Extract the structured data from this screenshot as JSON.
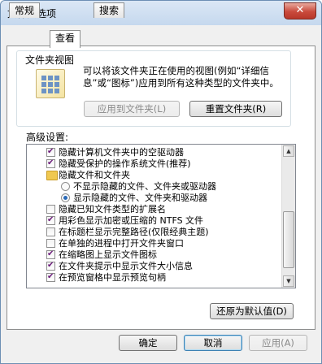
{
  "window": {
    "title": "文件夹选项",
    "close_glyph": "✕"
  },
  "tabs": [
    {
      "label": "常规",
      "active": false
    },
    {
      "label": "查看",
      "active": true
    },
    {
      "label": "搜索",
      "active": false
    }
  ],
  "folder_views": {
    "legend": "文件夹视图",
    "description": "可以将该文件夹正在使用的视图(例如“详细信息”或“图标”)应用到所有这种类型的文件夹中。",
    "apply_button": "应用到文件夹(L)",
    "reset_button": "重置文件夹(R)"
  },
  "advanced": {
    "label": "高级设置:",
    "items": [
      {
        "type": "checkbox",
        "checked": true,
        "indent": 0,
        "text": "隐藏计算机文件夹中的空驱动器"
      },
      {
        "type": "checkbox",
        "checked": true,
        "indent": 0,
        "text": "隐藏受保护的操作系统文件(推荐)"
      },
      {
        "type": "folder",
        "checked": false,
        "indent": 0,
        "text": "隐藏文件和文件夹"
      },
      {
        "type": "radio",
        "checked": false,
        "indent": 1,
        "text": "不显示隐藏的文件、文件夹或驱动器"
      },
      {
        "type": "radio",
        "checked": true,
        "indent": 1,
        "text": "显示隐藏的文件、文件夹和驱动器"
      },
      {
        "type": "checkbox",
        "checked": false,
        "indent": 0,
        "text": "隐藏已知文件类型的扩展名"
      },
      {
        "type": "checkbox",
        "checked": true,
        "indent": 0,
        "text": "用彩色显示加密或压缩的 NTFS 文件"
      },
      {
        "type": "checkbox",
        "checked": false,
        "indent": 0,
        "text": "在标题栏显示完整路径(仅限经典主题)"
      },
      {
        "type": "checkbox",
        "checked": false,
        "indent": 0,
        "text": "在单独的进程中打开文件夹窗口"
      },
      {
        "type": "checkbox",
        "checked": true,
        "indent": 0,
        "text": "在缩略图上显示文件图标"
      },
      {
        "type": "checkbox",
        "checked": true,
        "indent": 0,
        "text": "在文件夹提示中显示文件大小信息"
      },
      {
        "type": "checkbox",
        "checked": true,
        "indent": 0,
        "text": "在预览窗格中显示预览句柄"
      }
    ],
    "restore_button": "还原为默认值(D)"
  },
  "footer": {
    "ok": "确定",
    "cancel": "取消",
    "apply": "应用(A)"
  }
}
